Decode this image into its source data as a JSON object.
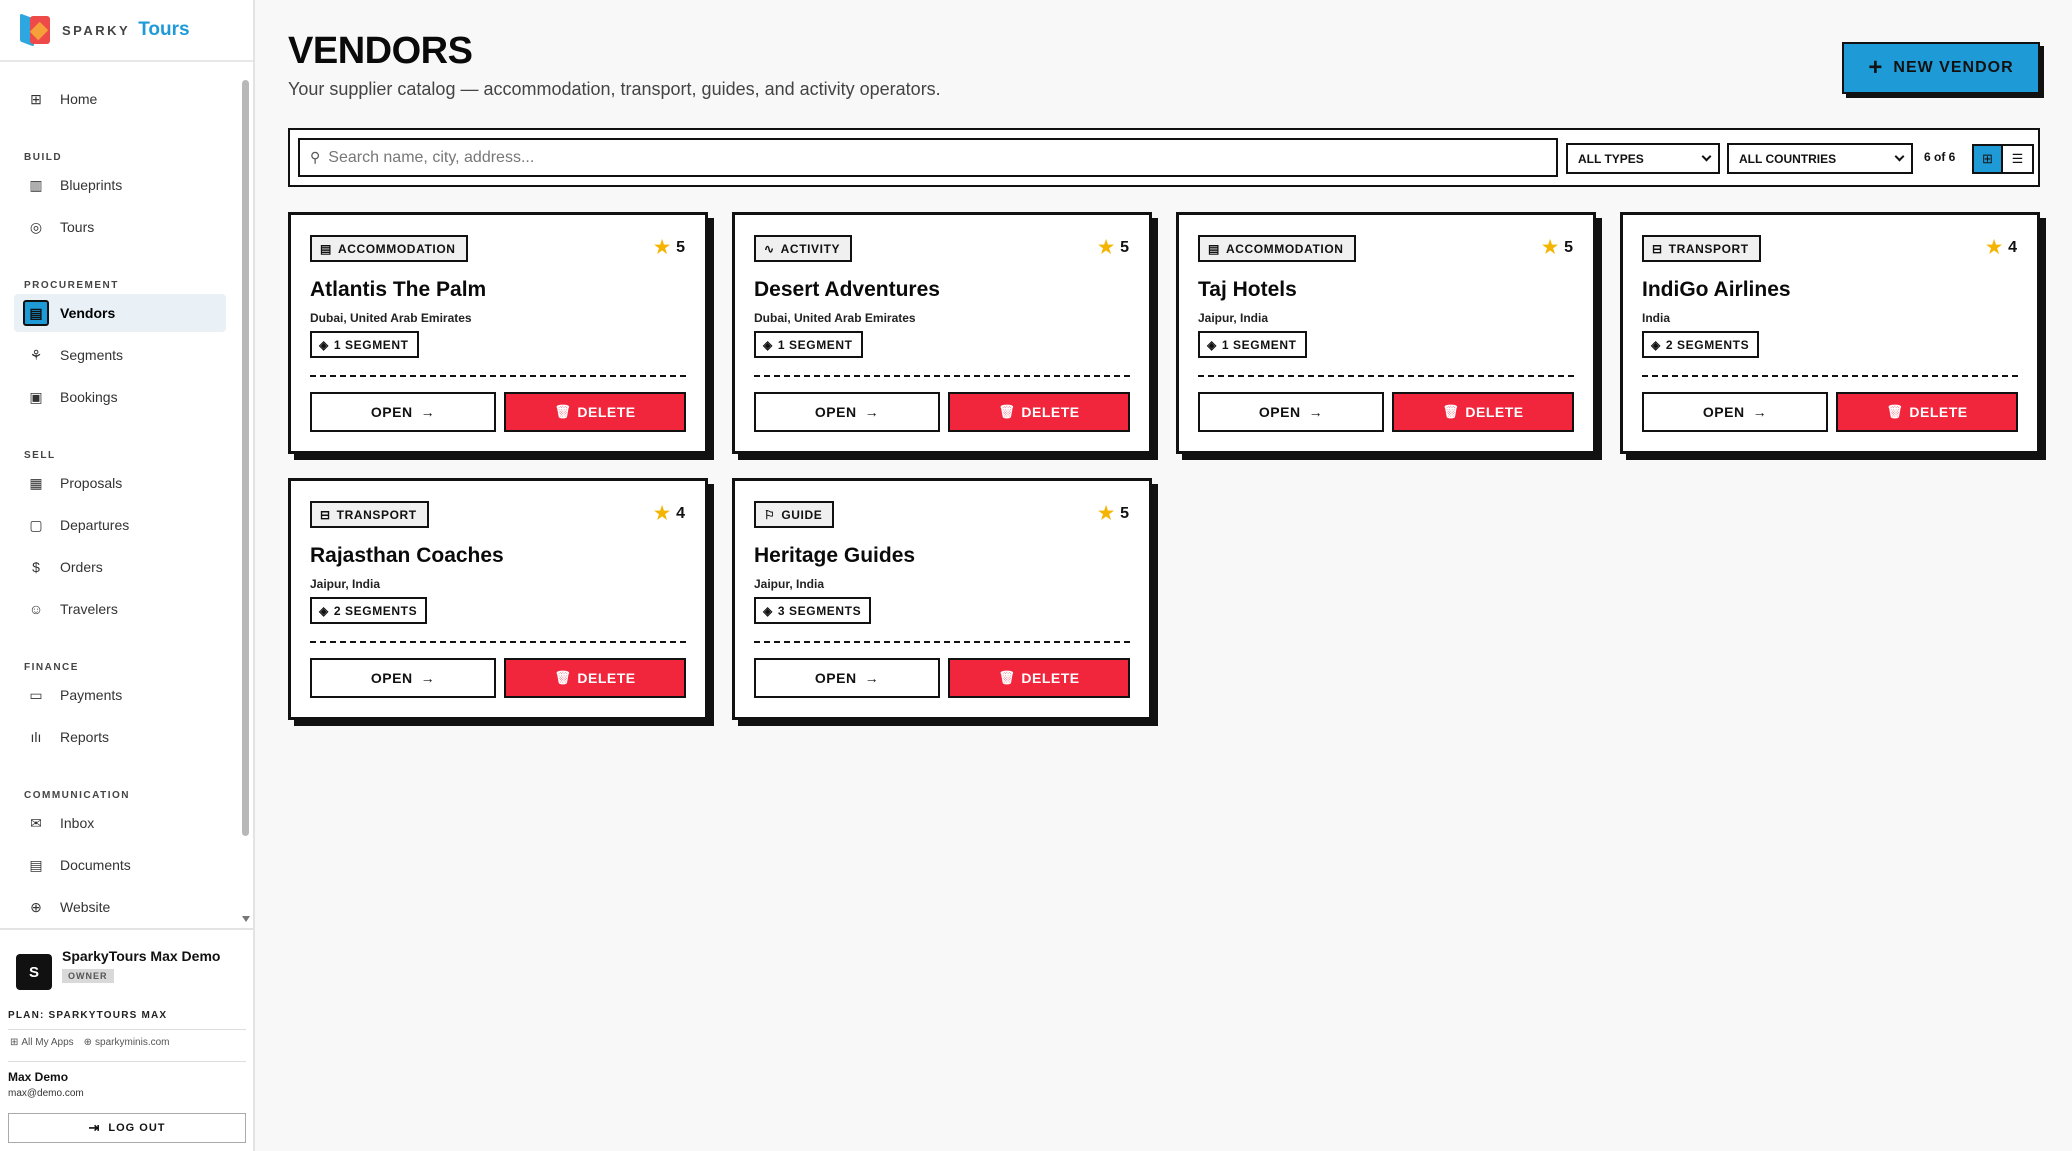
{
  "brand": {
    "sparky": "SPARKY",
    "tours": "Tours"
  },
  "nav": {
    "home": "Home",
    "sections": {
      "build": "BUILD",
      "procurement": "PROCUREMENT",
      "sell": "SELL",
      "finance": "FINANCE",
      "communication": "COMMUNICATION"
    },
    "items": {
      "blueprints": "Blueprints",
      "tours": "Tours",
      "vendors": "Vendors",
      "segments": "Segments",
      "bookings": "Bookings",
      "proposals": "Proposals",
      "departures": "Departures",
      "orders": "Orders",
      "travelers": "Travelers",
      "payments": "Payments",
      "reports": "Reports",
      "inbox": "Inbox",
      "documents": "Documents",
      "website": "Website"
    },
    "active": "vendors"
  },
  "footer": {
    "org_initial": "S",
    "org_name": "SparkyTours Max Demo",
    "role": "OWNER",
    "plan": "PLAN: SPARKYTOURS MAX",
    "all_apps": "All My Apps",
    "site": "sparkyminis.com",
    "user_name": "Max Demo",
    "user_email": "max@demo.com",
    "logout": "LOG OUT"
  },
  "page": {
    "title": "VENDORS",
    "subtitle": "Your supplier catalog — accommodation, transport, guides, and activity operators.",
    "new_vendor": "NEW VENDOR"
  },
  "filters": {
    "search_placeholder": "Search name, city, address...",
    "type": "ALL TYPES",
    "country": "ALL COUNTRIES",
    "count": "6 of 6",
    "view": "grid"
  },
  "actions": {
    "open": "OPEN",
    "delete": "DELETE"
  },
  "vendors": [
    {
      "type": "ACCOMMODATION",
      "type_icon": "building-icon",
      "rating": "5",
      "name": "Atlantis The Palm",
      "location": "Dubai, United Arab Emirates",
      "segments": "1 SEGMENT"
    },
    {
      "type": "ACTIVITY",
      "type_icon": "activity-icon",
      "rating": "5",
      "name": "Desert Adventures",
      "location": "Dubai, United Arab Emirates",
      "segments": "1 SEGMENT"
    },
    {
      "type": "ACCOMMODATION",
      "type_icon": "building-icon",
      "rating": "5",
      "name": "Taj Hotels",
      "location": "Jaipur, India",
      "segments": "1 SEGMENT"
    },
    {
      "type": "TRANSPORT",
      "type_icon": "bus-icon",
      "rating": "4",
      "name": "IndiGo Airlines",
      "location": "India",
      "segments": "2 SEGMENTS"
    },
    {
      "type": "TRANSPORT",
      "type_icon": "bus-icon",
      "rating": "4",
      "name": "Rajasthan Coaches",
      "location": "Jaipur, India",
      "segments": "2 SEGMENTS"
    },
    {
      "type": "GUIDE",
      "type_icon": "flag-icon",
      "rating": "5",
      "name": "Heritage Guides",
      "location": "Jaipur, India",
      "segments": "3 SEGMENTS"
    }
  ],
  "colors": {
    "accent": "#1e9bd7",
    "danger": "#f1253c",
    "star": "#f5b400",
    "ink": "#111111"
  }
}
